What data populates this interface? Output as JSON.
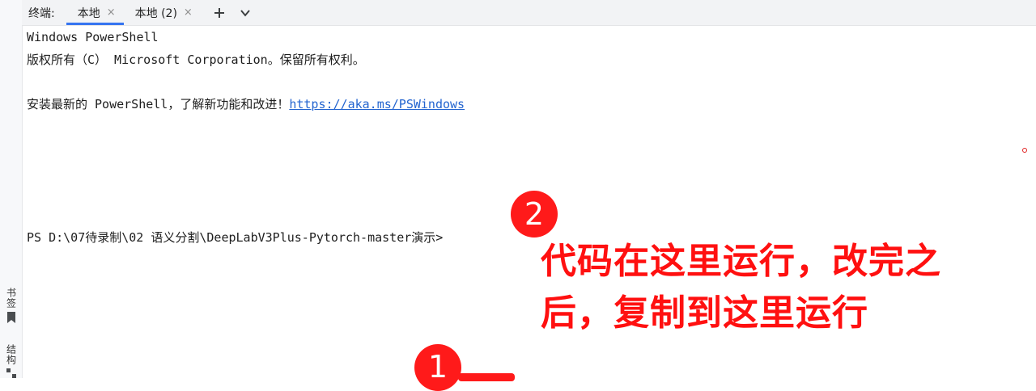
{
  "tabbar": {
    "title": "终端:",
    "tabs": [
      {
        "label": "本地",
        "active": true
      },
      {
        "label": "本地 (2)",
        "active": false
      }
    ],
    "add_icon": "plus-icon",
    "dropdown_icon": "chevron-down-icon",
    "close_glyph": "×",
    "add_glyph": "+",
    "dropdown_glyph": "⌄"
  },
  "sidebar": {
    "bookmarks_label": "书签",
    "structure_label": "结构"
  },
  "terminal": {
    "line1": "Windows PowerShell",
    "line2": "版权所有（C） Microsoft Corporation。保留所有权利。",
    "line3_prefix": "安装最新的 PowerShell，了解新功能和改进！",
    "line3_link": "https://aka.ms/PSWindows",
    "prompt": "PS D:\\07待录制\\02 语义分割\\DeepLabV3Plus-Pytorch-master演示>"
  },
  "annotations": {
    "badge_2": "2",
    "badge_1": "1",
    "note_line1": "代码在这里运行，改完之",
    "note_line2": "后，复制到这里运行",
    "accent_color": "#ff1a1a"
  }
}
